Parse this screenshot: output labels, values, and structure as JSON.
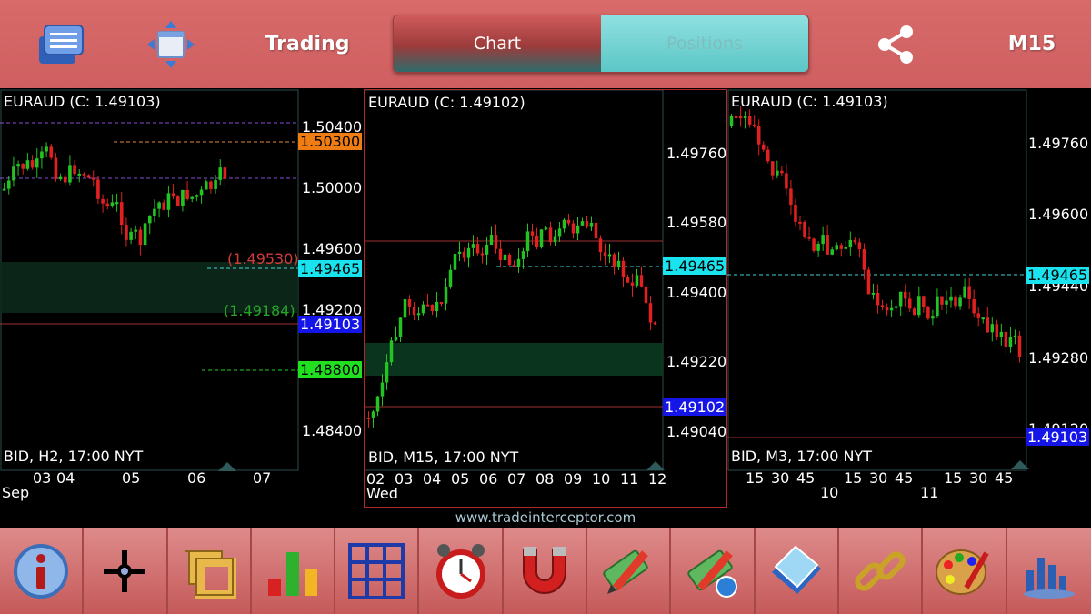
{
  "header": {
    "title": "Trading",
    "tabs": [
      {
        "label": "Chart",
        "active": true
      },
      {
        "label": "Positions",
        "active": false
      }
    ],
    "timeframe": "M15",
    "icons": [
      "menu-icon",
      "move-icon",
      "share-icon"
    ]
  },
  "charts": [
    {
      "title": "EURAUD (C: 1.49103)",
      "footer": "BID, H2, 17:00 NYT",
      "price_labels": [
        "1.50400",
        "1.50000",
        "1.49600",
        "1.49200",
        "1.48400"
      ],
      "tags": {
        "orange": "1.50300",
        "cyan": "1.49465",
        "blue": "1.49103",
        "green": "1.48800"
      },
      "inline_labels": {
        "red": "(1.49530)",
        "green": "(1.49184)"
      },
      "x_ticks": [
        "03",
        "04",
        "05",
        "06",
        "07"
      ],
      "x_sub": "Sep"
    },
    {
      "title": "EURAUD (C: 1.49102)",
      "footer": "BID, M15, 17:00 NYT",
      "price_labels": [
        "1.49760",
        "1.49580",
        "1.49400",
        "1.49220",
        "1.49040"
      ],
      "tags": {
        "cyan": "1.49465",
        "blue": "1.49102"
      },
      "x_ticks": [
        "02",
        "03",
        "04",
        "05",
        "06",
        "07",
        "08",
        "09",
        "10",
        "11",
        "12"
      ],
      "x_sub": "Wed"
    },
    {
      "title": "EURAUD (C: 1.49103)",
      "footer": "BID, M3, 17:00 NYT",
      "price_labels": [
        "1.49760",
        "1.49600",
        "1.49440",
        "1.49280",
        "1.49120"
      ],
      "tags": {
        "cyan": "1.49465",
        "blue": "1.49103"
      },
      "x_ticks": [
        "15",
        "30",
        "45",
        "15",
        "30",
        "45",
        "15",
        "30",
        "45"
      ],
      "x_sub_ticks": [
        "10",
        "11"
      ]
    }
  ],
  "footer": {
    "url": "www.tradeinterceptor.com",
    "tools": [
      "info-icon",
      "crosshair-icon",
      "ruler-icon",
      "indicators-icon",
      "grid-icon",
      "alarm-clock-icon",
      "magnet-icon",
      "pencil-money-icon",
      "pencil-money-globe-icon",
      "layers-icon",
      "link-icon",
      "palette-icon",
      "chart-settings-icon"
    ]
  }
}
